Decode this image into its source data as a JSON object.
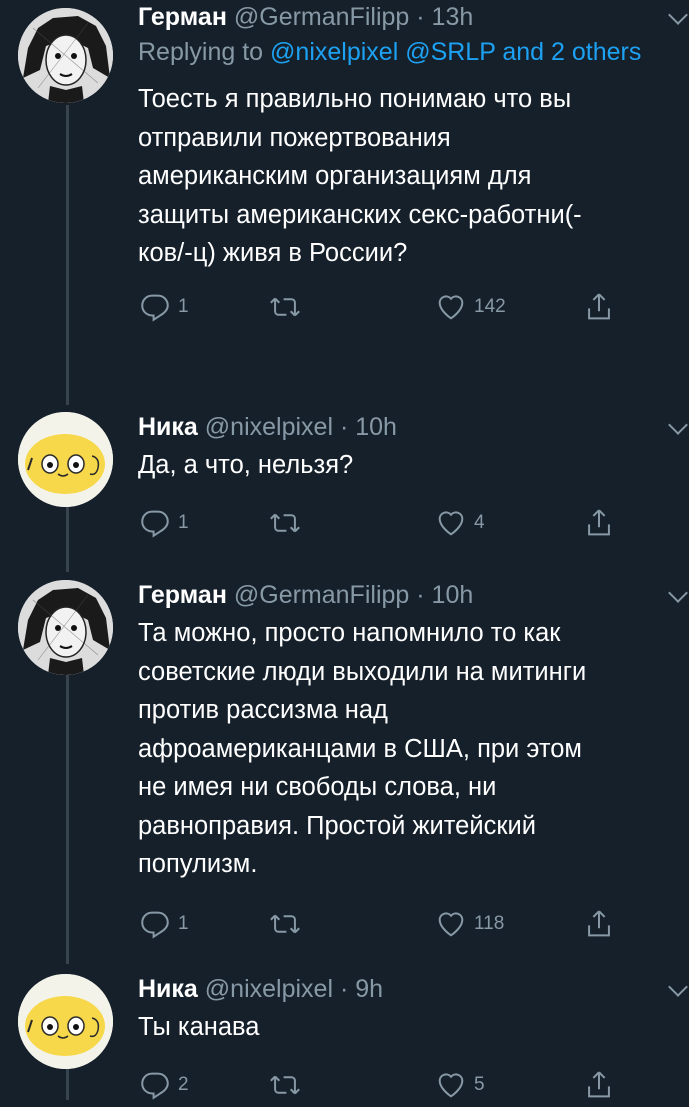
{
  "tweets": [
    {
      "name": "Герман",
      "handle": "@GermanFilipp",
      "time": "· 13h",
      "reply_prefix": "Replying to ",
      "reply_to": "@nixelpixel @SRLP and 2 others",
      "text": "Тоесть я правильно понимаю что вы\nотправили пожертвования\nамериканским организациям для\nзащиты американских секс-работни(-\nков/-ц) живя в России?",
      "replies": "1",
      "retweets": "",
      "likes": "142"
    },
    {
      "name": "Ника",
      "handle": "@nixelpixel",
      "time": "· 10h",
      "text": "Да, а что, нельзя?",
      "replies": "1",
      "retweets": "",
      "likes": "4"
    },
    {
      "name": "Герман",
      "handle": "@GermanFilipp",
      "time": "· 10h",
      "text": "Та можно, просто напомнило то как\nсоветские люди выходили на митинги\nпротив рассизма над\nафроамериканцами в США, при этом\nне имея ни свободы слова, ни\nравноправия. Простой житейский\nпопулизм.",
      "replies": "1",
      "retweets": "",
      "likes": "118"
    },
    {
      "name": "Ника",
      "handle": "@nixelpixel",
      "time": "· 9h",
      "text": "Ты канава",
      "replies": "2",
      "retweets": "",
      "likes": "5"
    }
  ],
  "icons": {
    "reply": "reply-icon",
    "retweet": "retweet-icon",
    "like": "heart-icon",
    "share": "share-icon",
    "more": "chevron-down-icon"
  },
  "colors": {
    "background": "#15202b",
    "secondary_text": "#8899a6",
    "link": "#1da1f2",
    "thread_line": "#38444d"
  }
}
